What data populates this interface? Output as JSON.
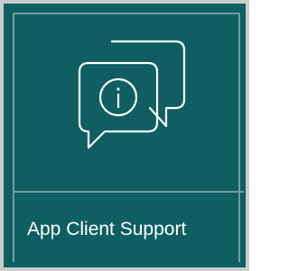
{
  "card": {
    "label": "App Client Support",
    "icon": "chat-bubbles-info-icon"
  },
  "colors": {
    "background": "#0f5f62",
    "border": "#c9cccc",
    "frame_lines": "#6f9ea0",
    "text": "#ffffff"
  }
}
